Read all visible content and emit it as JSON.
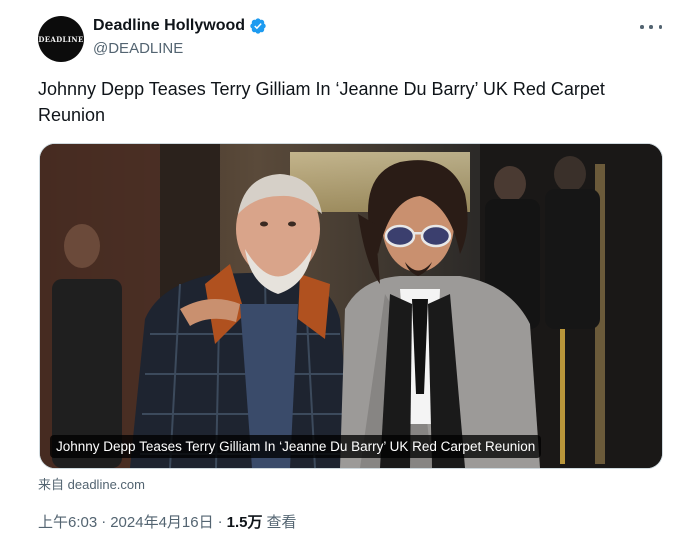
{
  "author": {
    "avatar_text": "DEADLINE",
    "display_name": "Deadline Hollywood",
    "handle": "@DEADLINE",
    "verified_color": "#1d9bf0"
  },
  "tweet": {
    "text": "Johnny Depp Teases Terry Gilliam In ‘Jeanne Du Barry’ UK Red Carpet Reunion"
  },
  "card": {
    "caption": "Johnny Depp Teases Terry Gilliam In ‘Jeanne Du Barry’ UK Red Carpet Reunion",
    "source_prefix": "来自",
    "source_domain": "deadline.com"
  },
  "meta": {
    "time": "上午6:03",
    "separator": "·",
    "date": "2024年4月16日",
    "views_count": "1.5万",
    "views_label": "查看"
  },
  "icons": {
    "more": "more-horizontal-icon",
    "verified": "verified-badge-icon"
  }
}
